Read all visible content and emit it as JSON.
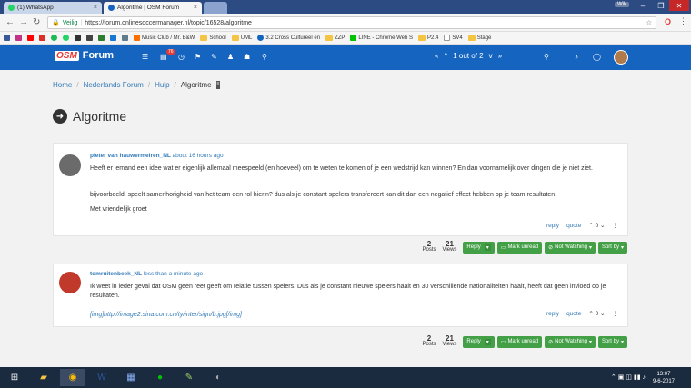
{
  "browser": {
    "tabs": [
      {
        "title": "(1) WhatsApp",
        "close": "×"
      },
      {
        "title": "Algoritme | OSM Forum",
        "close": "×"
      }
    ],
    "window_user": "Wik",
    "secure_label": "Veilig",
    "url": "https://forum.onlinesoccermanager.nl/topic/16528/algoritme",
    "bookmarks": [
      "Music Club / Mr. B&W",
      "School",
      "UML",
      "3.2 Cross Cultureel en",
      "ZZP",
      "LINE - Chrome Web S",
      "P2.4",
      "SV4",
      "Stage"
    ]
  },
  "forum": {
    "logo": "OSM",
    "brand": "Forum",
    "notif_count": "76",
    "pager": "1 out of 2"
  },
  "breadcrumb": {
    "items": [
      "Home",
      "Nederlands Forum",
      "Hulp"
    ],
    "current": "Algoritme",
    "sep": "/"
  },
  "topic": {
    "title": "Algoritme"
  },
  "posts": [
    {
      "author": "pieter van hauwermeiren_NL",
      "time": "about 16 hours ago",
      "paragraphs": [
        "Heeft er iemand een idee wat er eigenlijk allemaal meespeeld (en hoeveel) om te weten te komen of je een wedstrijd kan winnen? En dan voornamelijk over dingen die je niet ziet.",
        "bijvoorbeeld: speelt samenhorigheid van het team een rol hierin? dus als je constant spelers transfereert kan dit dan een negatief effect hebben op je team resultaten.",
        "Met vriendelijk groet"
      ],
      "reply": "reply",
      "quote": "quote",
      "votes": "0"
    },
    {
      "author": "tomruitenbeek_NL",
      "time": "less than a minute ago",
      "paragraphs": [
        "Ik weet in ieder geval dat OSM geen reet geeft om relatie tussen spelers. Dus als je constant nieuwe spelers haalt en 30 verschillende nationaliteiten haalt, heeft dat geen invloed op je resultaten.",
        "[img]http://image2.sina.com.cn/ty/inter/sign/b.jpg[/img]"
      ],
      "reply": "reply",
      "quote": "quote",
      "votes": "0"
    }
  ],
  "toolbar": {
    "posts_count": "2",
    "posts_label": "Posts",
    "views_count": "21",
    "views_label": "Views",
    "reply": "Reply",
    "mark_unread": "Mark unread",
    "not_watching": "Not Watching",
    "sort_by": "Sort by"
  },
  "taskbar": {
    "time": "13:07",
    "date": "9-6-2017"
  },
  "colors": {
    "brand_blue": "#1565c0",
    "button_green": "#43a047",
    "link": "#337ab7"
  }
}
